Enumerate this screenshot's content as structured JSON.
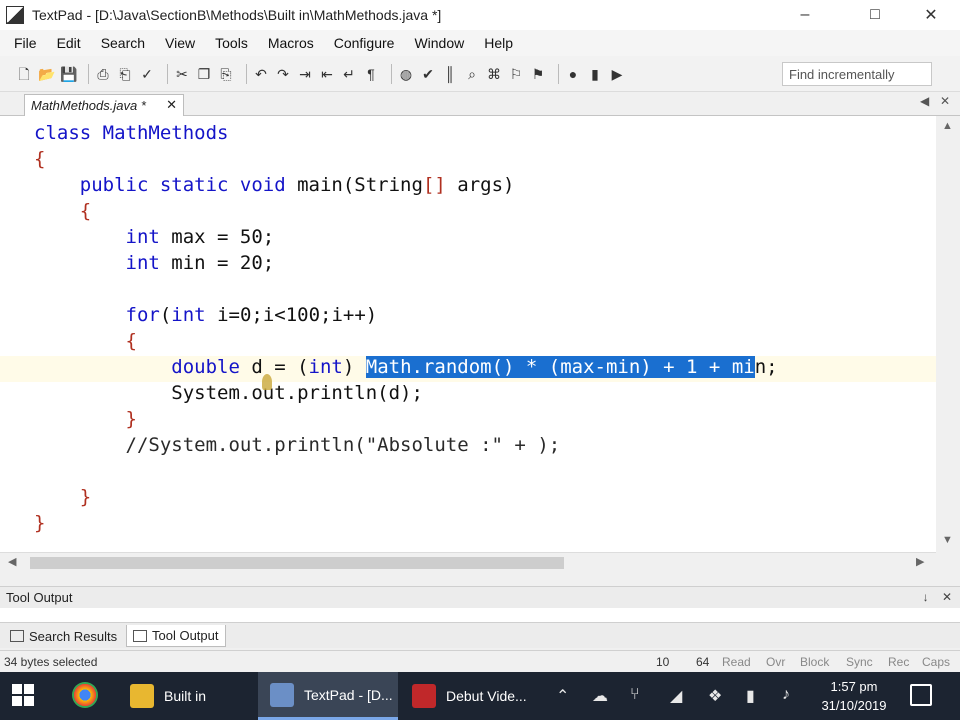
{
  "window": {
    "title": "TextPad - [D:\\Java\\SectionB\\Methods\\Built in\\MathMethods.java *]",
    "minimize": "–",
    "maximize": "□",
    "close": "✕"
  },
  "menu": [
    "File",
    "Edit",
    "Search",
    "View",
    "Tools",
    "Macros",
    "Configure",
    "Window",
    "Help"
  ],
  "toolbar": {
    "find_placeholder": "Find incrementally"
  },
  "document_tab": {
    "label": "MathMethods.java *",
    "close": "✕"
  },
  "editor": {
    "lines": [
      {
        "tokens": [
          {
            "t": "class MathMethods",
            "c": "kw"
          }
        ]
      },
      {
        "tokens": [
          {
            "t": "{",
            "c": "br"
          }
        ]
      },
      {
        "tokens": [
          {
            "t": "    public static void ",
            "c": "kw"
          },
          {
            "t": "main(String",
            "c": "tx"
          },
          {
            "t": "[]",
            "c": "br"
          },
          {
            "t": " args)",
            "c": "tx"
          }
        ]
      },
      {
        "tokens": [
          {
            "t": "    {",
            "c": "br"
          }
        ]
      },
      {
        "tokens": [
          {
            "t": "        int ",
            "c": "kw"
          },
          {
            "t": "max = 50;",
            "c": "tx"
          }
        ]
      },
      {
        "tokens": [
          {
            "t": "        int ",
            "c": "kw"
          },
          {
            "t": "min = 20;",
            "c": "tx"
          }
        ]
      },
      {
        "tokens": [
          {
            "t": "",
            "c": "tx"
          }
        ]
      },
      {
        "tokens": [
          {
            "t": "        for",
            "c": "kw"
          },
          {
            "t": "(",
            "c": "tx"
          },
          {
            "t": "int ",
            "c": "kw"
          },
          {
            "t": "i=0;i<100;i++)",
            "c": "tx"
          }
        ]
      },
      {
        "tokens": [
          {
            "t": "        {",
            "c": "br"
          }
        ]
      },
      {
        "tokens": [
          {
            "t": "            double ",
            "c": "kw"
          },
          {
            "t": "d = (",
            "c": "tx"
          },
          {
            "t": "int",
            "c": "kw"
          },
          {
            "t": ") ",
            "c": "tx"
          },
          {
            "t": "Math.random() * (max-min) + 1 + mi",
            "c": "sel"
          },
          {
            "t": "n;",
            "c": "tx"
          }
        ]
      },
      {
        "tokens": [
          {
            "t": "            System.out.println(d);",
            "c": "tx"
          }
        ]
      },
      {
        "tokens": [
          {
            "t": "        }",
            "c": "br"
          }
        ]
      },
      {
        "tokens": [
          {
            "t": "        //System.out.println(\"Absolute :\" + );",
            "c": "cm"
          }
        ]
      },
      {
        "tokens": [
          {
            "t": "",
            "c": "tx"
          }
        ]
      },
      {
        "tokens": [
          {
            "t": "    }",
            "c": "br"
          }
        ]
      },
      {
        "tokens": [
          {
            "t": "}",
            "c": "br"
          }
        ]
      }
    ]
  },
  "tool_panel": {
    "title": "Tool Output",
    "tabs": [
      "Search Results",
      "Tool Output"
    ],
    "active_tab": "Tool Output"
  },
  "statusbar": {
    "message": "34 bytes selected",
    "line": "10",
    "col": "64",
    "read": "Read",
    "ovr": "Ovr",
    "block": "Block",
    "sync": "Sync",
    "rec": "Rec",
    "caps": "Caps"
  },
  "taskbar": {
    "items": [
      {
        "label": "Built in",
        "active": false
      },
      {
        "label": "TextPad - [D...",
        "active": true
      },
      {
        "label": "Debut Vide...",
        "active": false
      }
    ],
    "time": "1:57 pm",
    "date": "31/10/2019"
  }
}
